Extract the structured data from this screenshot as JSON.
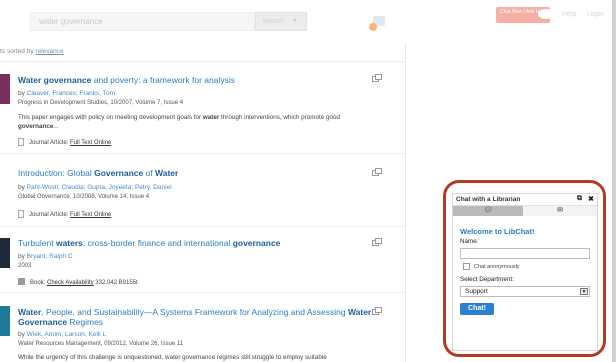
{
  "header": {
    "search_value": "water governance",
    "search_button": "Search",
    "badge_text": "Chat Now / Ask Us",
    "links": [
      "Help",
      "Login"
    ]
  },
  "sort": {
    "prefix": "ts sorted by",
    "link": "relevance"
  },
  "results": [
    {
      "title_parts": [
        [
          "Water governance",
          true
        ],
        [
          " and poverty: a framework for analysis",
          false
        ]
      ],
      "authors_prefix": "by ",
      "authors": "Cleaver, Frances; Franks, Tom",
      "source": "Progress in Development Studies, 10/2007, Volume 7, Issue 4",
      "snippet_html": "This paper engages with policy on meeting development goals for <b>water</b> through interventions, which promote good <b>governance</b>...",
      "format_type": "Journal Article:",
      "format_link": "Full Text Online"
    },
    {
      "title_parts": [
        [
          "Introduction: Global ",
          false
        ],
        [
          "Governance",
          true
        ],
        [
          " of ",
          false
        ],
        [
          "Water",
          true
        ]
      ],
      "authors_prefix": "by ",
      "authors": "Pahl-Wostl, Claudia; Gupta, Joyeeta; Petry, Daniel",
      "source": "Global Governance, 10/2008, Volume 14, Issue 4",
      "format_type": "Journal Article:",
      "format_link": "Full Text Online"
    },
    {
      "title_parts": [
        [
          "Turbulent ",
          false
        ],
        [
          "waters",
          true
        ],
        [
          ": cross-border finance and international ",
          false
        ],
        [
          "governance",
          true
        ]
      ],
      "authors_prefix": "by ",
      "authors": "Bryant, Ralph C",
      "source": "2003",
      "format_type": "Book:",
      "format_link": "Check Availability",
      "format_extra": "332.042 B9155t"
    },
    {
      "title_parts": [
        [
          "Water",
          true
        ],
        [
          ", People, and Sustainability—A Systems Framework for Analyzing and Assessing ",
          false
        ],
        [
          "Water",
          true
        ]
      ],
      "title_line2": [
        [
          "Governance",
          true
        ],
        [
          " Regimes",
          false
        ]
      ],
      "authors_prefix": "by ",
      "authors": "Wiek, Arnim; Larson, Kelli L",
      "source": "Water Resources Management, 09/2012, Volume 26, Issue 11",
      "snippet_html": "While the urgency of this challenge is unquestioned, water governance regimes still struggle to employ suitable"
    }
  ],
  "chat": {
    "title": "Chat with a Librarian",
    "welcome": "Welcome to LibChat!",
    "name_label": "Name:",
    "name_value": "",
    "anon_label": "Chat anonymously",
    "dept_label": "Select Department:",
    "dept_value": "Support",
    "submit": "Chat!"
  },
  "colors": {
    "link": "#2a7fc0",
    "highlight_circle": "#b43a26",
    "chat_button": "#2b7fd0"
  }
}
